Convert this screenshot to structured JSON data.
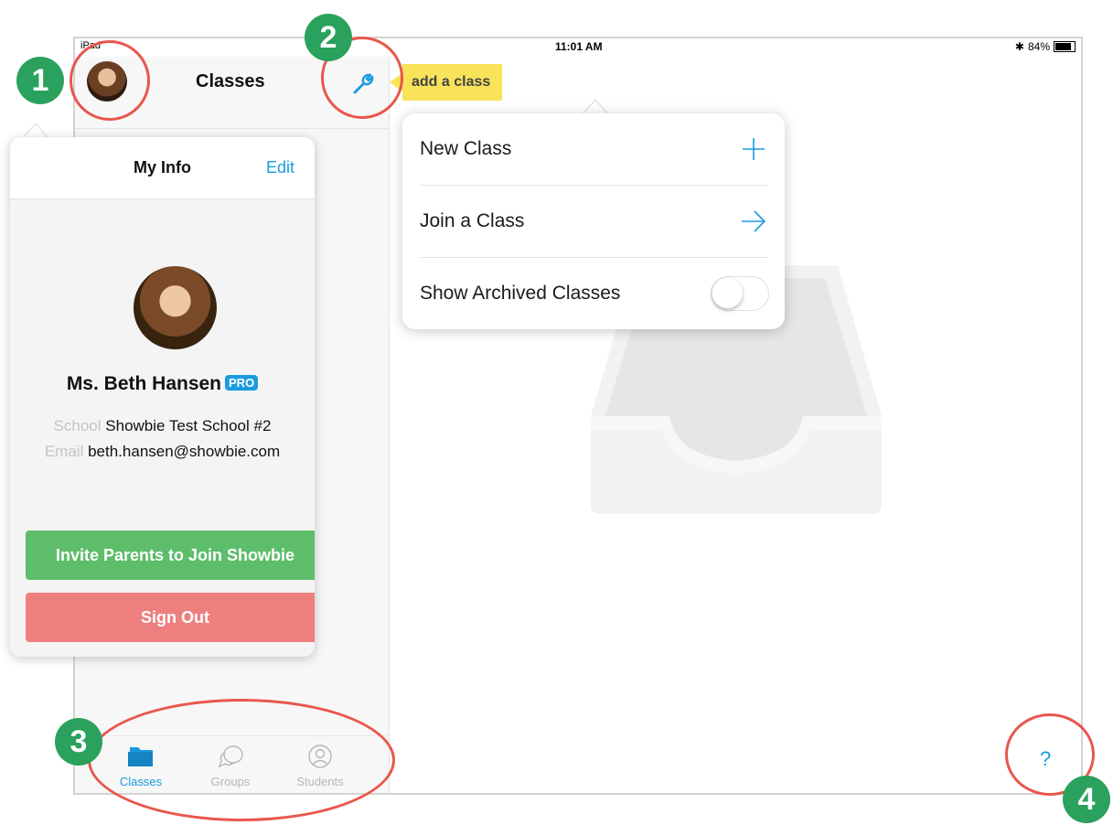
{
  "status_bar": {
    "carrier": "iPad",
    "time": "11:01 AM",
    "battery": "84%",
    "battery_level": 0.84
  },
  "nav": {
    "title": "Classes"
  },
  "tooltip": {
    "text": "add a class"
  },
  "popover_menu": {
    "items": [
      {
        "label": "New Class",
        "icon": "plus-icon"
      },
      {
        "label": "Join a Class",
        "icon": "arrow-right-icon"
      },
      {
        "label": "Show Archived Classes",
        "icon": "toggle-switch",
        "toggle_on": false
      }
    ]
  },
  "my_info": {
    "title": "My Info",
    "edit_label": "Edit",
    "name": "Ms. Beth Hansen",
    "badge": "PRO",
    "school_label": "School",
    "school": "Showbie Test School #2",
    "email_label": "Email",
    "email": "beth.hansen@showbie.com",
    "invite_button": "Invite Parents to Join Showbie",
    "signout_button": "Sign Out"
  },
  "tabs": [
    {
      "label": "Classes",
      "icon": "folder-icon",
      "active": true
    },
    {
      "label": "Groups",
      "icon": "chat-bubbles-icon",
      "active": false
    },
    {
      "label": "Students",
      "icon": "person-icon",
      "active": false
    }
  ],
  "help": {
    "label": "?"
  },
  "annotations": [
    "1",
    "2",
    "3",
    "4"
  ],
  "colors": {
    "accent": "#1a9be0",
    "annotation_ring": "#e8574c",
    "annotation_badge": "#2aa15c",
    "tooltip": "#f8e35a",
    "invite_button": "#5dbd6b",
    "signout_button": "#ee7f7f"
  }
}
